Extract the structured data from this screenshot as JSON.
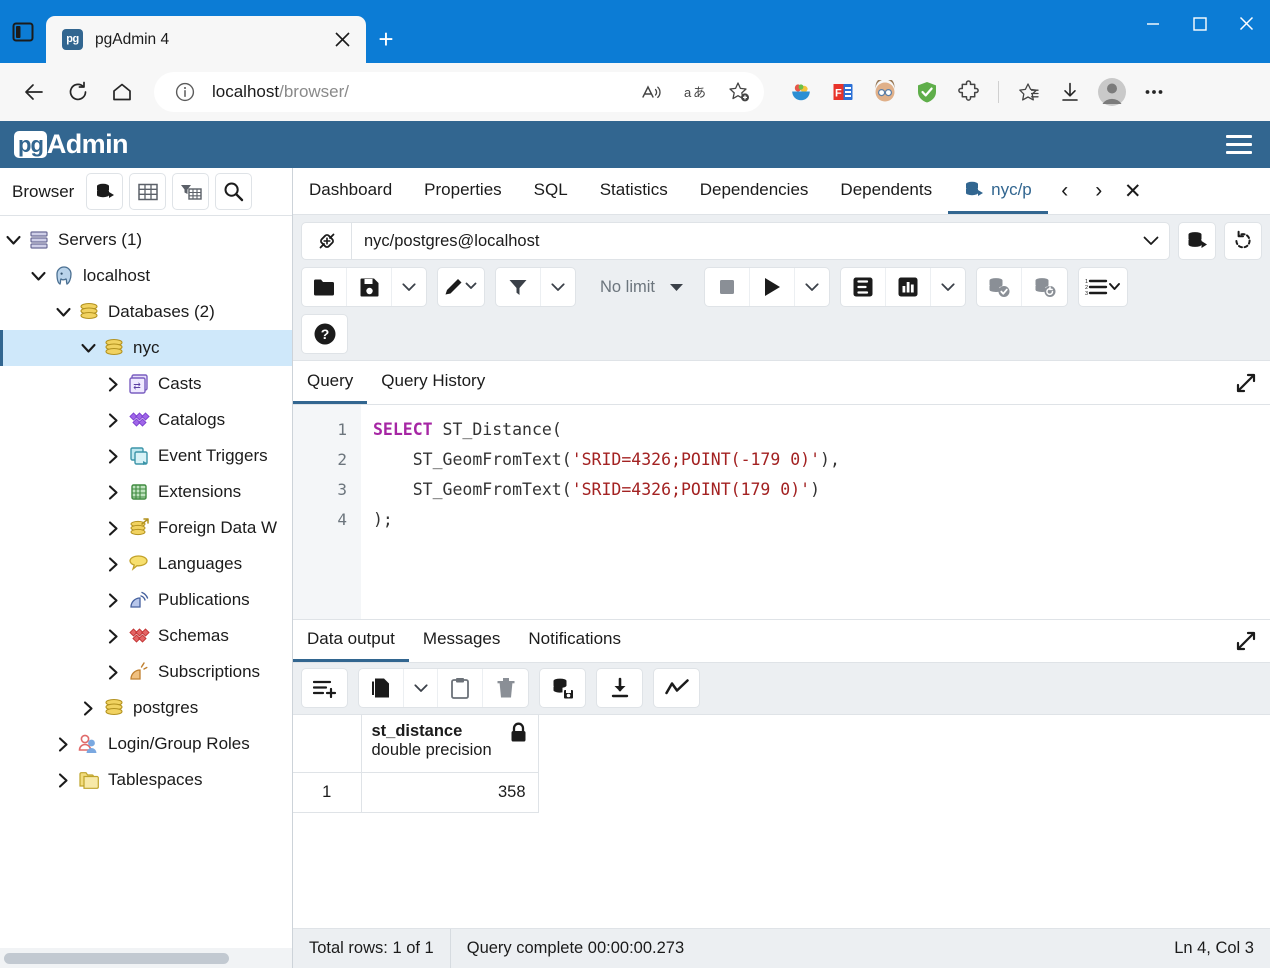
{
  "browser": {
    "tab": {
      "title": "pgAdmin 4",
      "favicon_label": "pg",
      "close_icon": "close-icon"
    },
    "newtab_label": "+",
    "window_controls": {
      "minimize": "—",
      "maximize": "□",
      "close": "✕"
    },
    "nav": {
      "back": "back-arrow-icon",
      "reload": "reload-icon",
      "home": "home-icon"
    },
    "omnibox": {
      "info_icon": "info-circle-icon",
      "url_host": "localhost",
      "url_path": "/browser/",
      "read_aloud": "read-aloud-icon",
      "translate": "translate-icon",
      "favorite": "add-favorite-icon"
    },
    "extensions": [
      "fruit-bowl-icon",
      "f-extension-icon",
      "avatar-extension-icon",
      "adblock-shield-icon",
      "puzzle-extensions-icon",
      "favorites-star-icon",
      "downloads-icon",
      "profile-avatar-icon",
      "more-settings-icon"
    ]
  },
  "app": {
    "logo_badge": "pg",
    "logo_text": "Admin",
    "menu_icon": "hamburger-menu-icon"
  },
  "sidebar": {
    "title": "Browser",
    "header_buttons": [
      "browser-tree-icon",
      "grid-icon",
      "filter-grid-icon",
      "search-icon"
    ],
    "tree": [
      {
        "label": "Servers (1)",
        "depth": 0,
        "expanded": true,
        "icon": "servers-icon",
        "selected": false
      },
      {
        "label": "localhost",
        "depth": 1,
        "expanded": true,
        "icon": "postgres-elephant-icon",
        "selected": false
      },
      {
        "label": "Databases (2)",
        "depth": 2,
        "expanded": true,
        "icon": "database-coins-icon",
        "selected": false
      },
      {
        "label": "nyc",
        "depth": 3,
        "expanded": true,
        "icon": "database-coins-icon",
        "selected": true
      },
      {
        "label": "Casts",
        "depth": 4,
        "expanded": false,
        "icon": "casts-icon",
        "selected": false
      },
      {
        "label": "Catalogs",
        "depth": 4,
        "expanded": false,
        "icon": "catalogs-icon",
        "selected": false
      },
      {
        "label": "Event Triggers",
        "depth": 4,
        "expanded": false,
        "icon": "event-triggers-icon",
        "selected": false
      },
      {
        "label": "Extensions",
        "depth": 4,
        "expanded": false,
        "icon": "extensions-icon",
        "selected": false
      },
      {
        "label": "Foreign Data W",
        "depth": 4,
        "expanded": false,
        "icon": "foreign-data-wrappers-icon",
        "selected": false
      },
      {
        "label": "Languages",
        "depth": 4,
        "expanded": false,
        "icon": "languages-icon",
        "selected": false
      },
      {
        "label": "Publications",
        "depth": 4,
        "expanded": false,
        "icon": "publications-icon",
        "selected": false
      },
      {
        "label": "Schemas",
        "depth": 4,
        "expanded": false,
        "icon": "schemas-icon",
        "selected": false
      },
      {
        "label": "Subscriptions",
        "depth": 4,
        "expanded": false,
        "icon": "subscriptions-icon",
        "selected": false
      },
      {
        "label": "postgres",
        "depth": 3,
        "expanded": false,
        "icon": "database-coins-icon",
        "selected": false
      },
      {
        "label": "Login/Group Roles",
        "depth": 2,
        "expanded": false,
        "icon": "login-group-roles-icon",
        "selected": false
      },
      {
        "label": "Tablespaces",
        "depth": 2,
        "expanded": false,
        "icon": "tablespaces-icon",
        "selected": false
      }
    ]
  },
  "object_tabs": {
    "items": [
      {
        "label": "Dashboard",
        "active": false
      },
      {
        "label": "Properties",
        "active": false
      },
      {
        "label": "SQL",
        "active": false
      },
      {
        "label": "Statistics",
        "active": false
      },
      {
        "label": "Dependencies",
        "active": false
      },
      {
        "label": "Dependents",
        "active": false
      },
      {
        "label": "nyc/p",
        "active": true,
        "icon": "query-tool-icon"
      }
    ],
    "prev_label": "‹",
    "next_label": "›",
    "close_label": "✕"
  },
  "query_toolbar": {
    "connection": "nyc/postgres@localhost",
    "connection_icon": "connection-plug-icon",
    "connection_caret": "chevron-down-icon",
    "manage_connections_icon": "manage-connections-icon",
    "reset_layout_icon": "reset-layout-icon",
    "buttons": [
      {
        "name": "open-file-icon",
        "type": "icon"
      },
      {
        "name": "save-file-icon",
        "type": "icon"
      },
      {
        "name": "save-chevron-down-icon",
        "type": "caret"
      },
      {
        "name": "edit-pencil-icon",
        "type": "icon-caret"
      },
      {
        "name": "filter-icon",
        "type": "icon"
      },
      {
        "name": "filter-chevron-down-icon",
        "type": "caret"
      },
      {
        "name": "row-limit-select",
        "type": "select",
        "label": "No limit"
      },
      {
        "name": "stop-query-icon",
        "type": "icon"
      },
      {
        "name": "execute-play-icon",
        "type": "icon"
      },
      {
        "name": "execute-chevron-down-icon",
        "type": "caret"
      },
      {
        "name": "explain-icon",
        "type": "icon"
      },
      {
        "name": "explain-analyze-icon",
        "type": "icon"
      },
      {
        "name": "explain-chevron-down-icon",
        "type": "caret"
      },
      {
        "name": "commit-icon",
        "type": "icon"
      },
      {
        "name": "rollback-icon",
        "type": "icon"
      },
      {
        "name": "macros-icon",
        "type": "icon-caret"
      },
      {
        "name": "help-icon",
        "type": "icon"
      }
    ],
    "row_limit_value": "No limit"
  },
  "editor": {
    "tabs": [
      {
        "label": "Query",
        "active": true
      },
      {
        "label": "Query History",
        "active": false
      }
    ],
    "expand_icon": "expand-panel-icon",
    "line_numbers": [
      "1",
      "2",
      "3",
      "4"
    ],
    "sql_lines": [
      {
        "parts": [
          {
            "t": "SELECT",
            "c": "kw"
          },
          {
            "t": " ST_Distance(",
            "c": ""
          }
        ]
      },
      {
        "parts": [
          {
            "t": "    ST_GeomFromText(",
            "c": ""
          },
          {
            "t": "'SRID=4326;POINT(-179 0)'",
            "c": "str"
          },
          {
            "t": "),",
            "c": ""
          }
        ]
      },
      {
        "parts": [
          {
            "t": "    ST_GeomFromText(",
            "c": ""
          },
          {
            "t": "'SRID=4326;POINT(179 0)'",
            "c": "str"
          },
          {
            "t": ")",
            "c": ""
          }
        ]
      },
      {
        "parts": [
          {
            "t": ");",
            "c": ""
          }
        ]
      }
    ]
  },
  "output": {
    "tabs": [
      {
        "label": "Data output",
        "active": true
      },
      {
        "label": "Messages",
        "active": false
      },
      {
        "label": "Notifications",
        "active": false
      }
    ],
    "expand_icon": "expand-panel-icon",
    "toolbar": [
      {
        "name": "add-row-icon"
      },
      {
        "name": "copy-icon"
      },
      {
        "name": "copy-chevron-down-icon"
      },
      {
        "name": "paste-icon"
      },
      {
        "name": "delete-row-icon"
      },
      {
        "name": "save-data-changes-icon"
      },
      {
        "name": "download-csv-icon"
      },
      {
        "name": "graph-visualiser-icon"
      }
    ],
    "grid": {
      "columns": [
        {
          "name": "st_distance",
          "type": "double precision",
          "lock_icon": "lock-icon"
        }
      ],
      "rows": [
        {
          "num": "1",
          "values": [
            "358"
          ]
        }
      ]
    }
  },
  "statusbar": {
    "total_rows": "Total rows: 1 of 1",
    "query_status": "Query complete 00:00:00.273",
    "cursor_position": "Ln 4, Col 3"
  },
  "colors": {
    "browser_accent": "#0c7cd5",
    "pg_header": "#326690",
    "tree_selection": "#cfe8fa",
    "toolbar_bg": "#eceff2",
    "sql_keyword": "#a626a4",
    "sql_string": "#a32222"
  }
}
